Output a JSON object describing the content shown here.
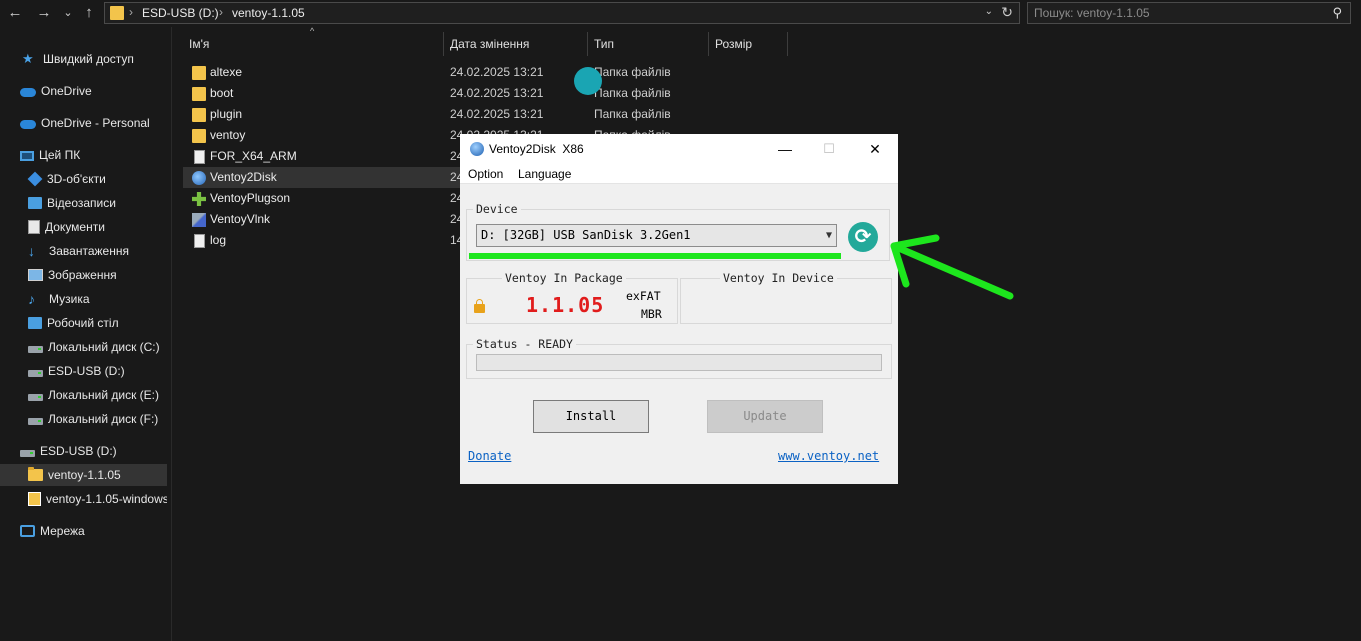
{
  "explorer": {
    "address": {
      "crumbs": [
        "ESD-USB (D:)",
        "ventoy-1.1.05"
      ],
      "separator": "›"
    },
    "search": {
      "placeholder": "Пошук: ventoy-1.1.05"
    },
    "nav": {
      "back": "←",
      "forward": "→",
      "recent": "⌄",
      "up": "↑"
    },
    "sidebar": {
      "items": [
        {
          "label": "Швидкий доступ",
          "icon": "star-icon"
        },
        {
          "label": "OneDrive",
          "icon": "cloud-icon"
        },
        {
          "label": "OneDrive - Personal",
          "icon": "cloud-icon"
        },
        {
          "label": "Цей ПК",
          "icon": "pc-icon"
        },
        {
          "label": "3D-об'єкти",
          "icon": "3d-objects-icon"
        },
        {
          "label": "Відеозаписи",
          "icon": "video-icon"
        },
        {
          "label": "Документи",
          "icon": "document-icon"
        },
        {
          "label": "Завантаження",
          "icon": "download-icon"
        },
        {
          "label": "Зображення",
          "icon": "picture-icon"
        },
        {
          "label": "Музика",
          "icon": "music-icon"
        },
        {
          "label": "Робочий стіл",
          "icon": "desktop-icon"
        },
        {
          "label": "Локальний диск (C:)",
          "icon": "drive-icon"
        },
        {
          "label": "ESD-USB (D:)",
          "icon": "drive-icon"
        },
        {
          "label": "Локальний диск (E:)",
          "icon": "drive-icon"
        },
        {
          "label": "Локальний диск (F:)",
          "icon": "drive-icon"
        },
        {
          "label": "ESD-USB (D:)",
          "icon": "drive-icon"
        },
        {
          "label": "ventoy-1.1.05",
          "icon": "folder-icon"
        },
        {
          "label": "ventoy-1.1.05-windows",
          "icon": "zip-folder-icon"
        },
        {
          "label": "Мережа",
          "icon": "network-icon"
        }
      ]
    },
    "columns": {
      "name": "Ім'я",
      "date": "Дата змінення",
      "type": "Тип",
      "size": "Розмір"
    },
    "files": [
      {
        "name": "altexe",
        "date": "24.02.2025 13:21",
        "type": "Папка файлів",
        "icon": "folder-icon"
      },
      {
        "name": "boot",
        "date": "24.02.2025 13:21",
        "type": "Папка файлів",
        "icon": "folder-icon"
      },
      {
        "name": "plugin",
        "date": "24.02.2025 13:21",
        "type": "Папка файлів",
        "icon": "folder-icon"
      },
      {
        "name": "ventoy",
        "date": "24.02.2025 13:21",
        "type": "Папка файлів",
        "icon": "folder-icon"
      },
      {
        "name": "FOR_X64_ARM",
        "date": "24",
        "type": "",
        "icon": "file-icon"
      },
      {
        "name": "Ventoy2Disk",
        "date": "24",
        "type": "",
        "icon": "ventoy-app-icon"
      },
      {
        "name": "VentoyPlugson",
        "date": "24",
        "type": "",
        "icon": "plugson-icon"
      },
      {
        "name": "VentoyVlnk",
        "date": "24",
        "type": "",
        "icon": "vlnk-icon"
      },
      {
        "name": "log",
        "date": "14",
        "type": "",
        "icon": "file-icon"
      }
    ]
  },
  "dialog": {
    "title": "Ventoy2Disk  X86",
    "window_buttons": {
      "minimize": "—",
      "maximize": "☐",
      "close": "✕"
    },
    "menu": [
      "Option",
      "Language"
    ],
    "device_group": "Device",
    "device_value": "D: [32GB] USB SanDisk 3.2Gen1",
    "package_group": "Ventoy In Package",
    "device_ventoy_group": "Ventoy In Device",
    "package_version": "1.1.05",
    "package_fs": "exFAT",
    "package_part": "MBR",
    "status_group": "Status - READY",
    "status_progress": 0,
    "install_label": "Install",
    "update_label": "Update",
    "donate_link": "Donate",
    "site_link": "www.ventoy.net"
  },
  "colors": {
    "explorer_bg": "#191919",
    "dialog_bg": "#f0f0f0",
    "version_red": "#e11c1c",
    "refresh_teal": "#23a99a",
    "annotation_green": "#1de61d",
    "cursor_teal": "#1aa5b3"
  }
}
